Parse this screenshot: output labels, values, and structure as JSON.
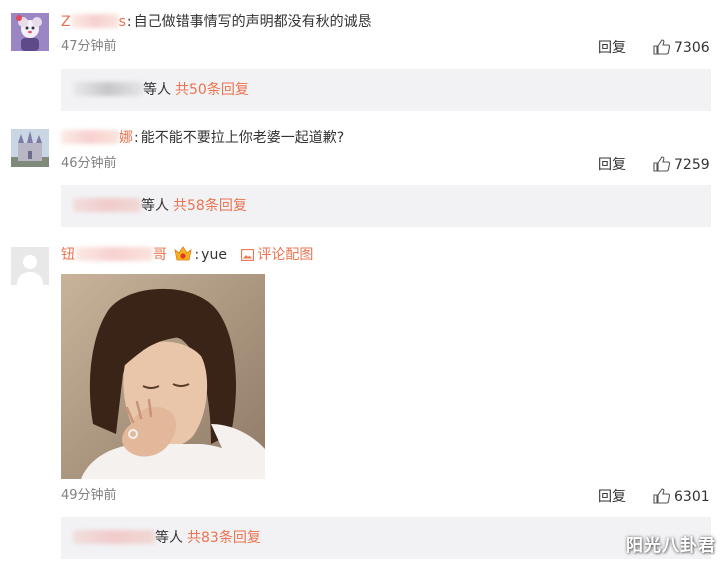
{
  "comments": [
    {
      "username_visible_start": "Z",
      "username_visible_end": "s",
      "text": "自己做错事情写的声明都没有秋的诚恳",
      "time": "47分钟前",
      "reply_label": "回复",
      "likes": "7306",
      "sub": {
        "who_suffix": "等人",
        "count_text": "共50条回复"
      }
    },
    {
      "username_visible_end": "娜",
      "text": "能不能不要拉上你老婆一起道歉?",
      "time": "46分钟前",
      "reply_label": "回复",
      "likes": "7259",
      "sub": {
        "who_suffix": "等人",
        "count_text": "共58条回复"
      }
    },
    {
      "username_visible_start": "钮",
      "username_visible_end": "哥",
      "text": "yue",
      "pic_link": "评论配图",
      "time": "49分钟前",
      "reply_label": "回复",
      "likes": "6301",
      "sub": {
        "who_suffix": "等人",
        "count_text": "共83条回复"
      }
    }
  ],
  "watermark": "阳光八卦君",
  "colors": {
    "accent": "#eb7350",
    "subbox_bg": "#f2f2f5",
    "meta_gray": "#808080"
  }
}
